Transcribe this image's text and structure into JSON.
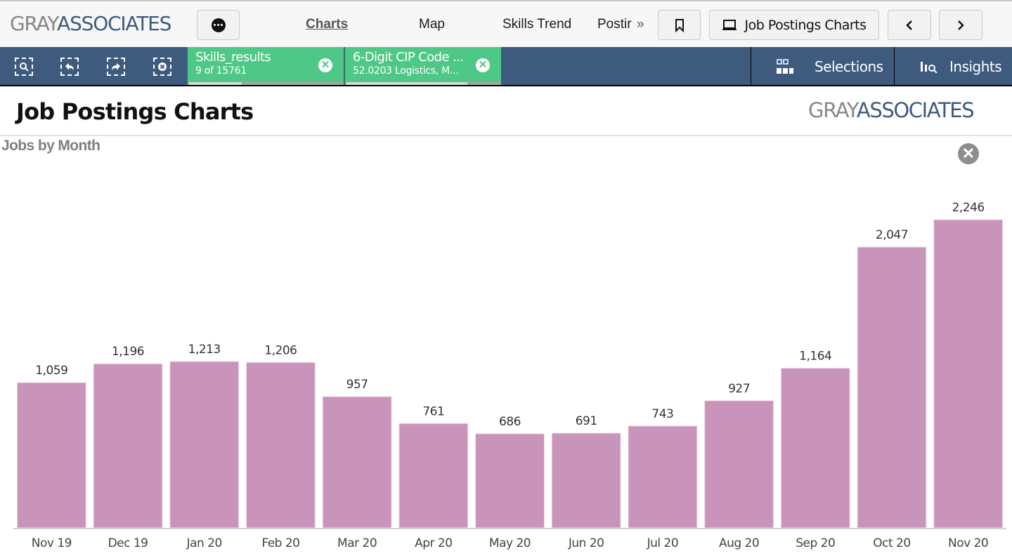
{
  "header": {
    "logo_gray": "GRAY",
    "logo_blue": "ASSOCIATES",
    "nav_tabs": [
      {
        "label": "Charts",
        "active": true
      },
      {
        "label": "Map",
        "active": false
      },
      {
        "label": "Skills Trend",
        "active": false
      },
      {
        "label": "Postir",
        "active": false
      }
    ],
    "more_glyph": "»",
    "sheet_button_label": "Job Postings Charts",
    "prev_glyph": "‹",
    "next_glyph": "›"
  },
  "selection_bar": {
    "chips": [
      {
        "title": "Skills_results",
        "subtitle": "9 of 15761",
        "progress": 0.45
      },
      {
        "title": "6-Digit CIP Code ...",
        "subtitle": "52.0203 Logistics, M...",
        "progress": 0.78
      }
    ],
    "selections_label": "Selections",
    "insights_label": "Insights"
  },
  "colors": {
    "brand_blue": "#3e5b7e",
    "chip_green": "#4ec886",
    "bar_color": "#c994b9"
  },
  "page": {
    "title": "Job Postings Charts"
  },
  "chart_data": {
    "type": "bar",
    "title": "Jobs by Month",
    "xlabel": "",
    "ylabel": "",
    "categories": [
      "Nov 19",
      "Dec 19",
      "Jan 20",
      "Feb 20",
      "Mar 20",
      "Apr 20",
      "May 20",
      "Jun 20",
      "Jul 20",
      "Aug 20",
      "Sep 20",
      "Oct 20",
      "Nov 20"
    ],
    "values": [
      1059,
      1196,
      1213,
      1206,
      957,
      761,
      686,
      691,
      743,
      927,
      1164,
      2047,
      2246
    ],
    "value_labels": [
      "1,059",
      "1,196",
      "1,213",
      "1,206",
      "957",
      "761",
      "686",
      "691",
      "743",
      "927",
      "1,164",
      "2,047",
      "2,246"
    ],
    "ylim": [
      0,
      2246
    ],
    "grid": false,
    "legend": "none"
  }
}
